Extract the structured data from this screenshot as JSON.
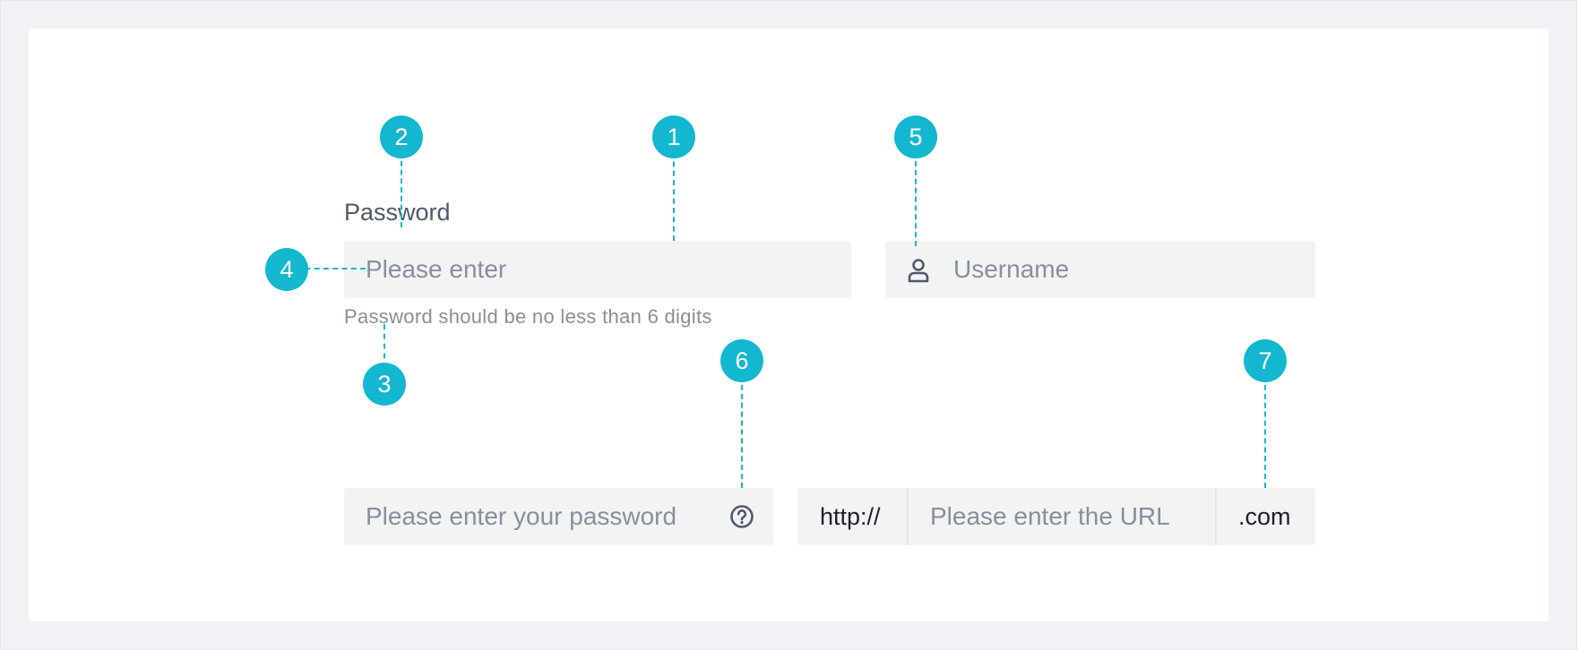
{
  "form": {
    "password_label": "Password",
    "password_placeholder": "Please enter",
    "password_help": "Password should be no less than 6 digits",
    "username_placeholder": "Username",
    "password2_placeholder": "Please enter your password",
    "url_prefix": "http://",
    "url_placeholder": "Please enter the URL",
    "url_suffix": ".com"
  },
  "icons": {
    "username": "user-icon",
    "password2": "question-circle-icon"
  },
  "callouts": [
    "1",
    "2",
    "3",
    "4",
    "5",
    "6",
    "7"
  ],
  "colors": {
    "accent": "#14b7d0",
    "input_bg": "#f2f3f5",
    "placeholder": "#86909c",
    "label": "#4e5969",
    "page_bg": "#f0f2f5"
  }
}
